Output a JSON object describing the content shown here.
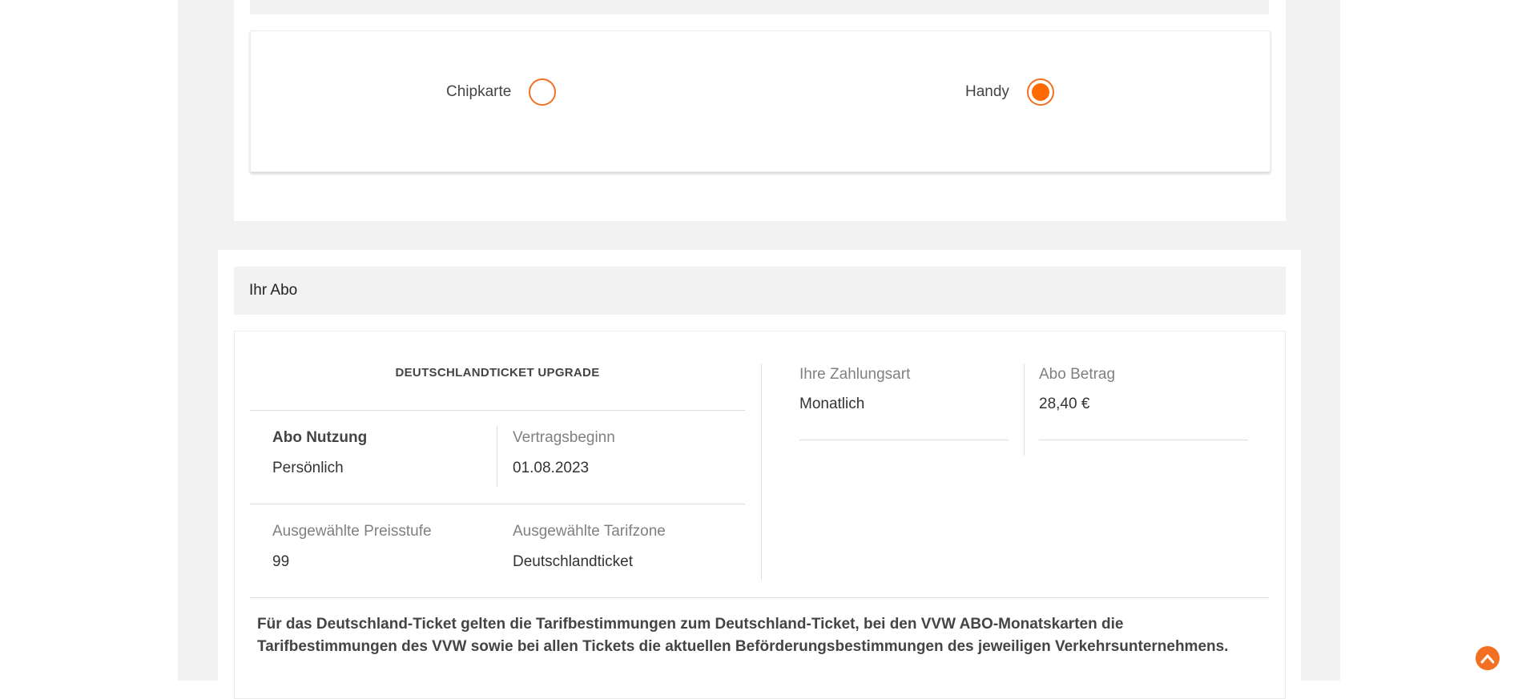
{
  "delivery": {
    "options": [
      {
        "label": "Chipkarte",
        "selected": false
      },
      {
        "label": "Handy",
        "selected": true
      }
    ]
  },
  "abo": {
    "section_title": "Ihr Abo",
    "ticket_name": "DEUTSCHLANDTICKET UPGRADE",
    "usage": {
      "label": "Abo Nutzung",
      "value": "Persönlich"
    },
    "contract_start": {
      "label": "Vertragsbeginn",
      "value": "01.08.2023"
    },
    "price_level": {
      "label": "Ausgewählte Preisstufe",
      "value": "99"
    },
    "tariff_zone": {
      "label": "Ausgewählte Tarifzone",
      "value": "Deutschlandticket"
    },
    "payment": {
      "label": "Ihre Zahlungsart",
      "value": "Monatlich"
    },
    "amount": {
      "label": "Abo Betrag",
      "value": "28,40 €"
    },
    "note": "Für das Deutschland-Ticket gelten die Tarifbestimmungen zum Deutschland-Ticket, bei den VVW ABO-Monatskarten die Tarifbestimmungen des VVW sowie bei allen Tickets die aktuellen Beförderungsbestimmungen des jeweiligen Verkehrsunternehmens."
  },
  "colors": {
    "accent": "#f36f21",
    "radio_fill": "#ff6a00",
    "panel_grey": "#f2f2f2"
  },
  "icons": {
    "scroll_top": "chevron-up-circle-icon"
  }
}
